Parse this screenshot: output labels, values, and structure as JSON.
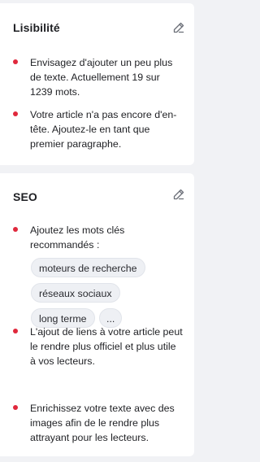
{
  "readability": {
    "title": "Lisibilité",
    "items": [
      "Envisagez d'ajouter un peu plus de texte. Actuellement 19 sur 1239 mots.",
      "Votre article n'a pas encore d'en-tête. Ajoutez-le en tant que premier paragraphe."
    ]
  },
  "seo": {
    "title": "SEO",
    "keywords_intro": "Ajoutez les mots clés recommandés :",
    "keywords": [
      "moteurs de recherche",
      "réseaux sociaux",
      "long terme"
    ],
    "more_label": "...",
    "items": [
      "L'ajout de liens à votre article peut le rendre plus officiel et plus utile à vos lecteurs.",
      "Enrichissez votre texte avec des images afin de le rendre plus attrayant pour les lecteurs."
    ]
  },
  "colors": {
    "bullet": "#e0283c",
    "background": "#f1f2f5",
    "card": "#ffffff"
  },
  "icons": {
    "edit": "pencil-icon"
  }
}
